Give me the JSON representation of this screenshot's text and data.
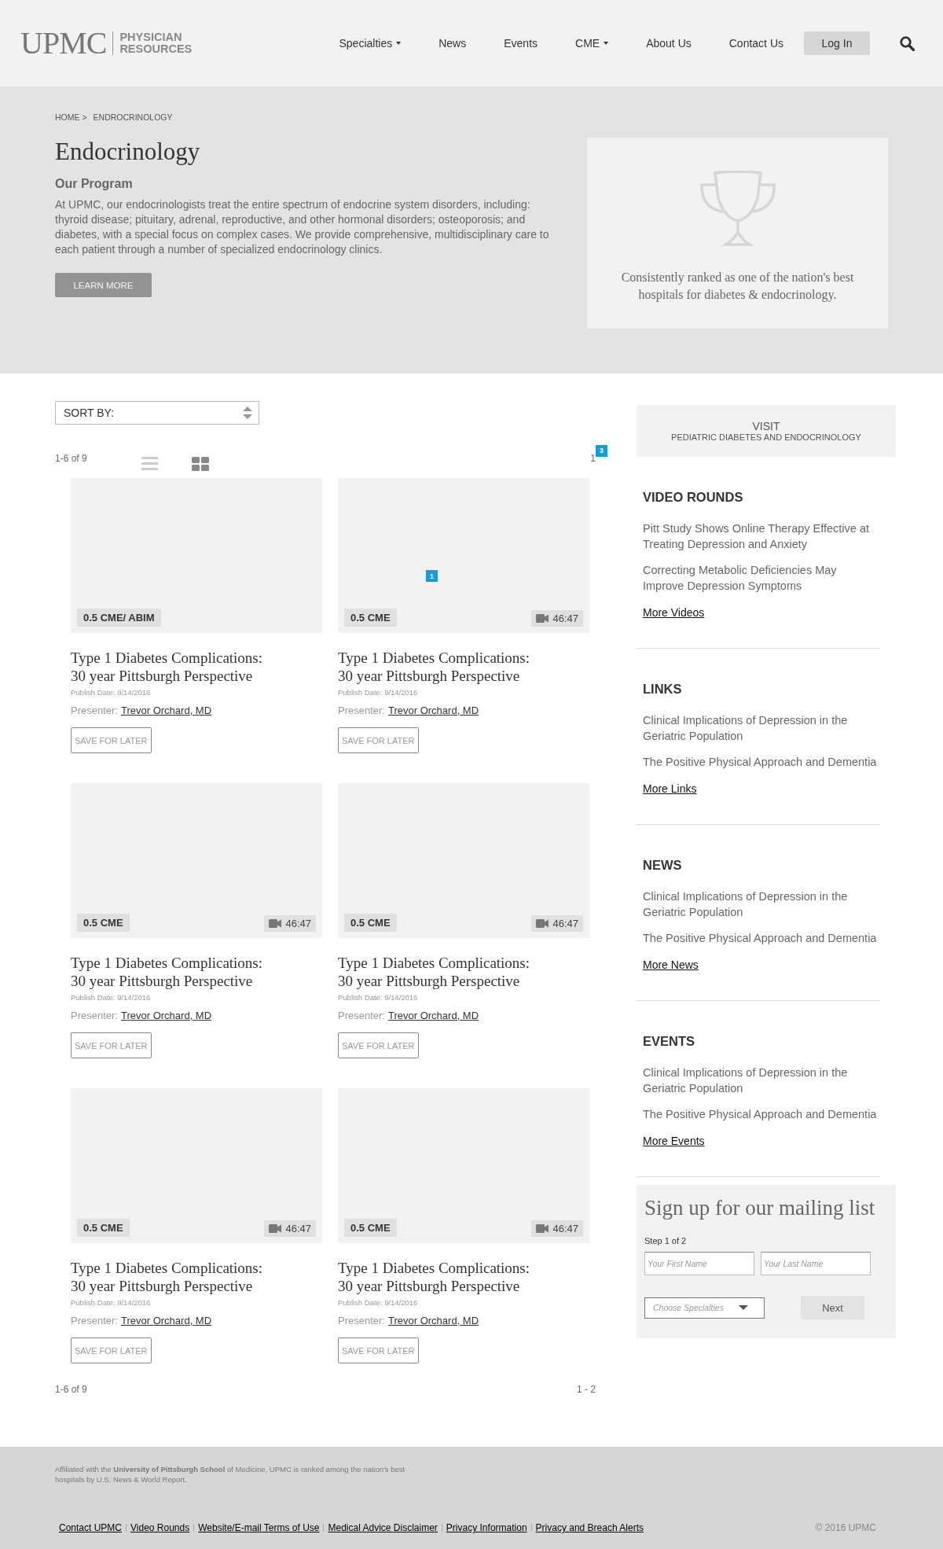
{
  "header": {
    "logo": {
      "mark": "UPMC",
      "line_1": "PHYSICIAN",
      "line_2": "RESOURCES"
    },
    "nav": [
      {
        "label": "Specialties",
        "dropdown": true
      },
      {
        "label": "News",
        "dropdown": false
      },
      {
        "label": "Events",
        "dropdown": false
      },
      {
        "label": "CME",
        "dropdown": true
      },
      {
        "label": "About Us",
        "dropdown": false
      },
      {
        "label": "Contact Us",
        "dropdown": false
      }
    ],
    "login": "Log In"
  },
  "hero": {
    "breadcrumb": [
      "HOME >",
      "ENDROCRINOLOGY"
    ],
    "title": "Endocrinology",
    "subtitle": "Our Program",
    "body": "At UPMC, our endocrinologists treat the entire spectrum of endocrine system disorders, including: thyroid disease; pituitary, adrenal, reproductive, and other hormonal disorders; osteoporosis; and diabetes, with a special focus on complex cases. We provide comprehensive, multidisciplinary care to each patient through a number of specialized endocrinology clinics.",
    "button": "LEARN MORE",
    "award": "Consistently ranked as one of the nation's best hospitals for diabetes & endocrinology."
  },
  "listing": {
    "sort_label": "SORT BY:",
    "count": "1-6 of 9",
    "views": [
      {
        "kind": "list",
        "selected": false
      },
      {
        "kind": "grid",
        "selected": true
      }
    ],
    "pagination": "1",
    "marker": "3",
    "card_marker": "1",
    "cards": [
      {
        "cme": "0.5 CME/ ABIM",
        "title": "Type 1 Diabetes Complications: 30 year Pittsburgh Perspective",
        "date": "Publish Date: 9/14/2016",
        "presenter_label": "Presenter:",
        "presenter": "Trevor Orchard, MD",
        "save": "SAVE FOR LATER"
      },
      {
        "cme": "0.5 CME",
        "duration": "46:47",
        "title": "Type 1 Diabetes Complications: 30 year Pittsburgh Perspective",
        "date": "Publish Date: 9/14/2016",
        "presenter_label": "Presenter:",
        "presenter": "Trevor Orchard, MD",
        "save": "SAVE FOR LATER"
      },
      {
        "cme": "0.5 CME",
        "duration": "46:47",
        "title": "Type 1 Diabetes Complications: 30 year Pittsburgh Perspective",
        "date": "Publish Date: 9/14/2016",
        "presenter_label": "Presenter:",
        "presenter": "Trevor Orchard, MD",
        "save": "SAVE FOR LATER"
      },
      {
        "cme": "0.5 CME",
        "duration": "46:47",
        "title": "Type 1 Diabetes Complications: 30 year Pittsburgh Perspective",
        "date": "Publish Date: 9/14/2016",
        "presenter_label": "Presenter:",
        "presenter": "Trevor Orchard, MD",
        "save": "SAVE FOR LATER"
      },
      {
        "cme": "0.5 CME",
        "duration": "46:47",
        "title": "Type 1 Diabetes Complications: 30 year Pittsburgh Perspective",
        "date": "Publish Date: 9/14/2016",
        "presenter_label": "Presenter:",
        "presenter": "Trevor Orchard, MD",
        "save": "SAVE FOR LATER"
      },
      {
        "cme": "0.5 CME",
        "duration": "46:47",
        "title": "Type 1 Diabetes Complications: 30 year Pittsburgh Perspective",
        "date": "Publish Date: 9/14/2016",
        "presenter_label": "Presenter:",
        "presenter": "Trevor Orchard, MD",
        "save": "SAVE FOR LATER"
      }
    ],
    "bottom_count": "1-6 of 9",
    "bottom_pagination": "1 - 2"
  },
  "sidebar": {
    "visit": {
      "label": "VISIT",
      "name": "PEDIATRIC DIABETES AND ENDOCRINOLOGY"
    },
    "sections": [
      {
        "heading": "VIDEO ROUNDS",
        "items": [
          "Pitt Study Shows Online Therapy Effective at Treating Depression and Anxiety",
          "Correcting Metabolic Deficiencies May Improve Depression Symptoms"
        ],
        "more": "More Videos"
      },
      {
        "heading": "LINKS",
        "items": [
          "Clinical Implications of Depression in the Geriatric Population",
          "The Positive Physical Approach and Dementia"
        ],
        "more": "More Links"
      },
      {
        "heading": "NEWS",
        "items": [
          "Clinical Implications of Depression in the Geriatric Population",
          "The Positive Physical Approach and Dementia"
        ],
        "more": "More News"
      },
      {
        "heading": "EVENTS",
        "items": [
          "Clinical Implications of Depression in the Geriatric Population",
          "The Positive Physical Approach and Dementia"
        ],
        "more": "More Events"
      }
    ],
    "mailing": {
      "title": "Sign up for our mailing list",
      "step": "Step 1 of 2",
      "first_name": {
        "placeholder": "Your First Name"
      },
      "last_name": {
        "placeholder": "Your Last Name"
      },
      "specialties": {
        "placeholder": "Choose Specialties"
      },
      "next": "Next"
    }
  },
  "footer": {
    "note": "Affiliated with the **University of Pittsburgh School** of Medicine, UPMC is ranked among the nation's best hospitals by U.S. News & World Report.",
    "links": [
      "Contact UPMC",
      "Video Rounds",
      "Website/E-mail Terms of Use",
      "Medical Advice Disclaimer",
      "Privacy Information",
      "Privacy and Breach Alerts"
    ],
    "copyright": "© 2016 UPMC"
  }
}
